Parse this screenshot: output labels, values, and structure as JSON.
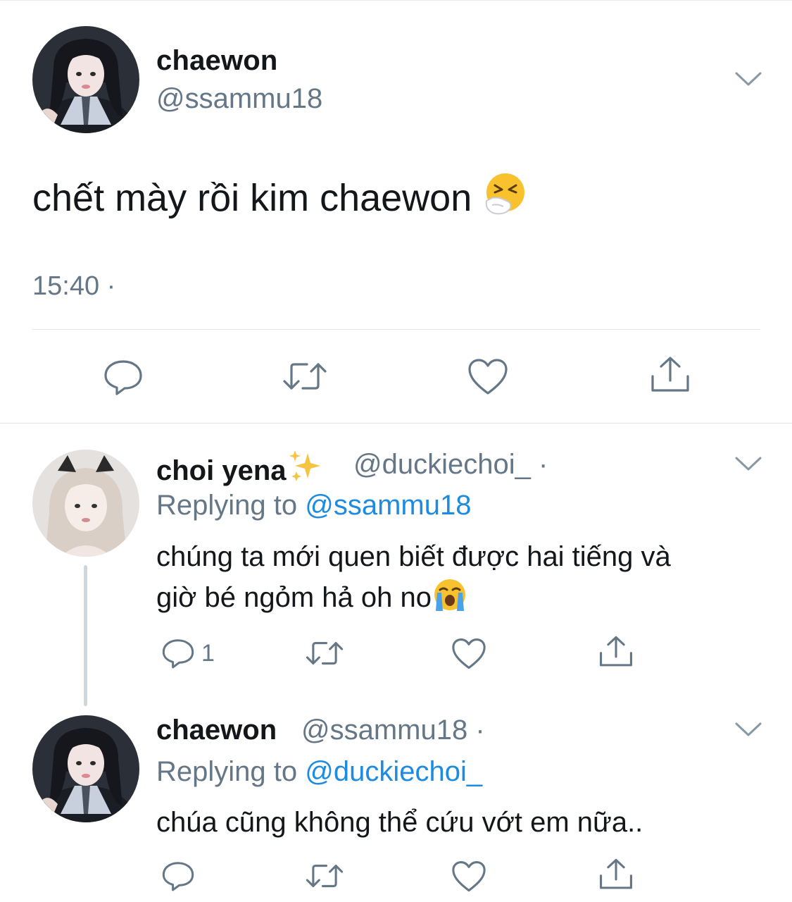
{
  "tweet": {
    "name": "chaewon",
    "handle": "@ssammu18",
    "text": "chết mày rồi kim chaewon",
    "text_emoji": "sneezing-face",
    "time": "15:40 ·"
  },
  "replies": [
    {
      "name": "choi yena",
      "name_emoji": "sparkles",
      "handle": "@duckiechoi_ ·",
      "replying_prefix": "Replying to",
      "replying_to": "@ssammu18",
      "text_line1": "chúng ta mới quen biết được hai tiếng và",
      "text_line2": "giờ bé ngỏm hả oh no",
      "text_emoji": "loudly-crying-face",
      "reply_count": "1"
    },
    {
      "name": "chaewon",
      "handle": "@ssammu18 ·",
      "replying_prefix": "Replying to",
      "replying_to": "@duckiechoi_",
      "text_line1": "chúa cũng không thể cứu vớt em nữa.."
    }
  ],
  "colors": {
    "text": "#14171a",
    "secondary": "#657786",
    "link": "#1d8ce0",
    "divider": "#dfe5ea"
  }
}
